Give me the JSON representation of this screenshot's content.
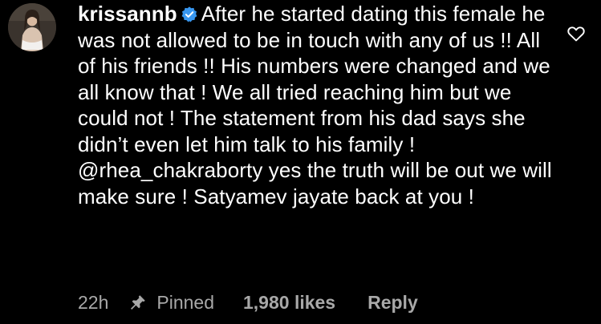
{
  "comment": {
    "username": "krissannb",
    "verified": true,
    "text": "After he started dating this female he was not allowed to be in touch with any of us !! All of his friends !! His numbers were changed and we all know that ! We all tried reaching him but we could not ! The statement from his dad says she didn’t even let him talk to his family ! @rhea_chakraborty yes the truth will be out we will make sure ! Satyamev jayate back at you !",
    "time": "22h",
    "pinned_label": "Pinned",
    "likes": "1,980 likes",
    "reply_label": "Reply"
  },
  "icons": {
    "avatar": "profile-photo",
    "verified": "verified-badge-icon",
    "like": "heart-icon",
    "pin": "pin-icon"
  },
  "colors": {
    "background": "#000000",
    "text": "#ffffff",
    "meta": "#a8a8a8",
    "verified": "#3897f0"
  }
}
